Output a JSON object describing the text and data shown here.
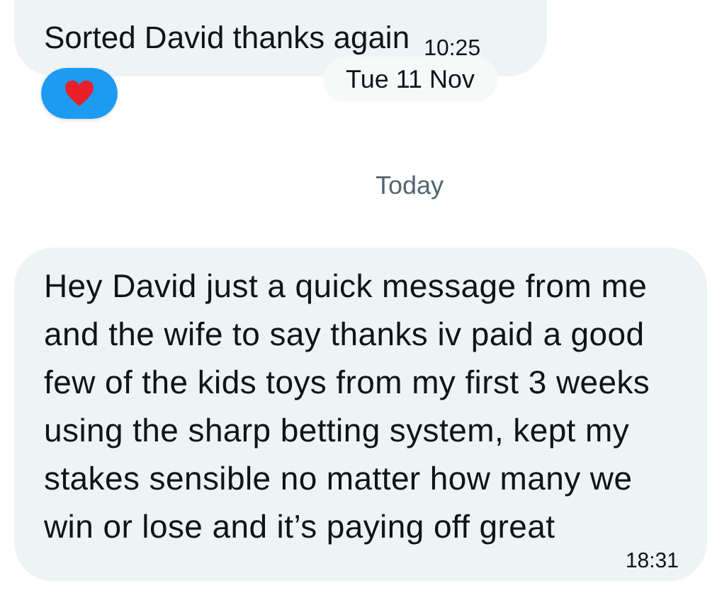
{
  "messages_before": [
    {
      "text": "Sorted David thanks again",
      "time": "10:25"
    }
  ],
  "date_pill": "Tue 11 Nov",
  "day_separator": "Today",
  "messages": [
    {
      "text": "Hey David just a quick message from me and the wife to say thanks iv paid a good few of the kids toys from my first 3 weeks using the sharp betting system, kept my stakes sensible no matter how many we win or lose and it’s paying off great",
      "time": "18:31"
    }
  ]
}
